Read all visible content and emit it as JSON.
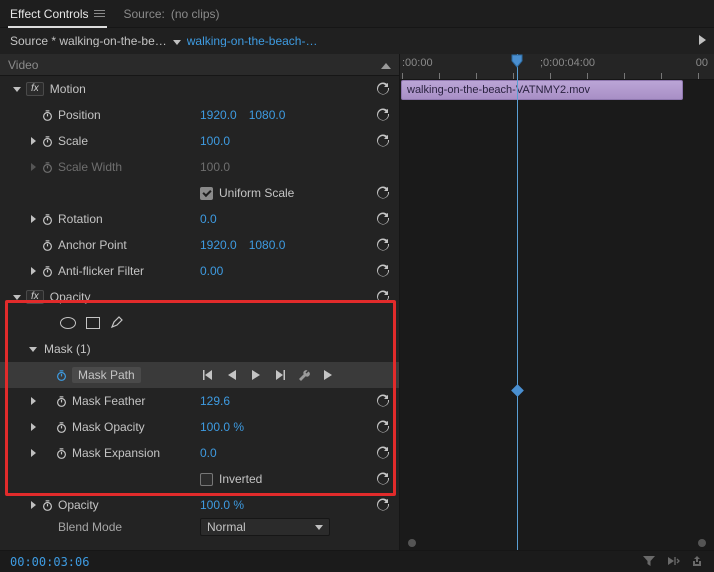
{
  "tabs": {
    "effect_controls": "Effect Controls",
    "source_label": "Source:",
    "source_value": "(no clips)"
  },
  "source_bar": {
    "source_clip": "Source * walking-on-the-be…",
    "sequence": "walking-on-the-beach-…"
  },
  "video_header": "Video",
  "motion": {
    "title": "Motion",
    "position": {
      "label": "Position",
      "x": "1920.0",
      "y": "1080.0"
    },
    "scale": {
      "label": "Scale",
      "value": "100.0"
    },
    "scale_width": {
      "label": "Scale Width",
      "value": "100.0"
    },
    "uniform": {
      "label": "Uniform Scale"
    },
    "rotation": {
      "label": "Rotation",
      "value": "0.0"
    },
    "anchor": {
      "label": "Anchor Point",
      "x": "1920.0",
      "y": "1080.0"
    },
    "antiflicker": {
      "label": "Anti-flicker Filter",
      "value": "0.00"
    }
  },
  "opacity_section": {
    "title": "Opacity",
    "mask": {
      "title": "Mask (1)",
      "path": {
        "label": "Mask Path"
      },
      "feather": {
        "label": "Mask Feather",
        "value": "129.6"
      },
      "mask_opacity": {
        "label": "Mask Opacity",
        "value": "100.0 %"
      },
      "expansion": {
        "label": "Mask Expansion",
        "value": "0.0"
      },
      "inverted": {
        "label": "Inverted"
      }
    },
    "opacity": {
      "label": "Opacity",
      "value": "100.0 %"
    },
    "blend": {
      "label": "Blend Mode",
      "value": "Normal"
    }
  },
  "timeline": {
    "ruler": {
      "t0": ":00:00",
      "t1": ";0:00:04:00",
      "t2": "00"
    },
    "clip_name": "walking-on-the-beach-VATNMY2.mov"
  },
  "status": {
    "timecode": "00:00:03:06"
  }
}
